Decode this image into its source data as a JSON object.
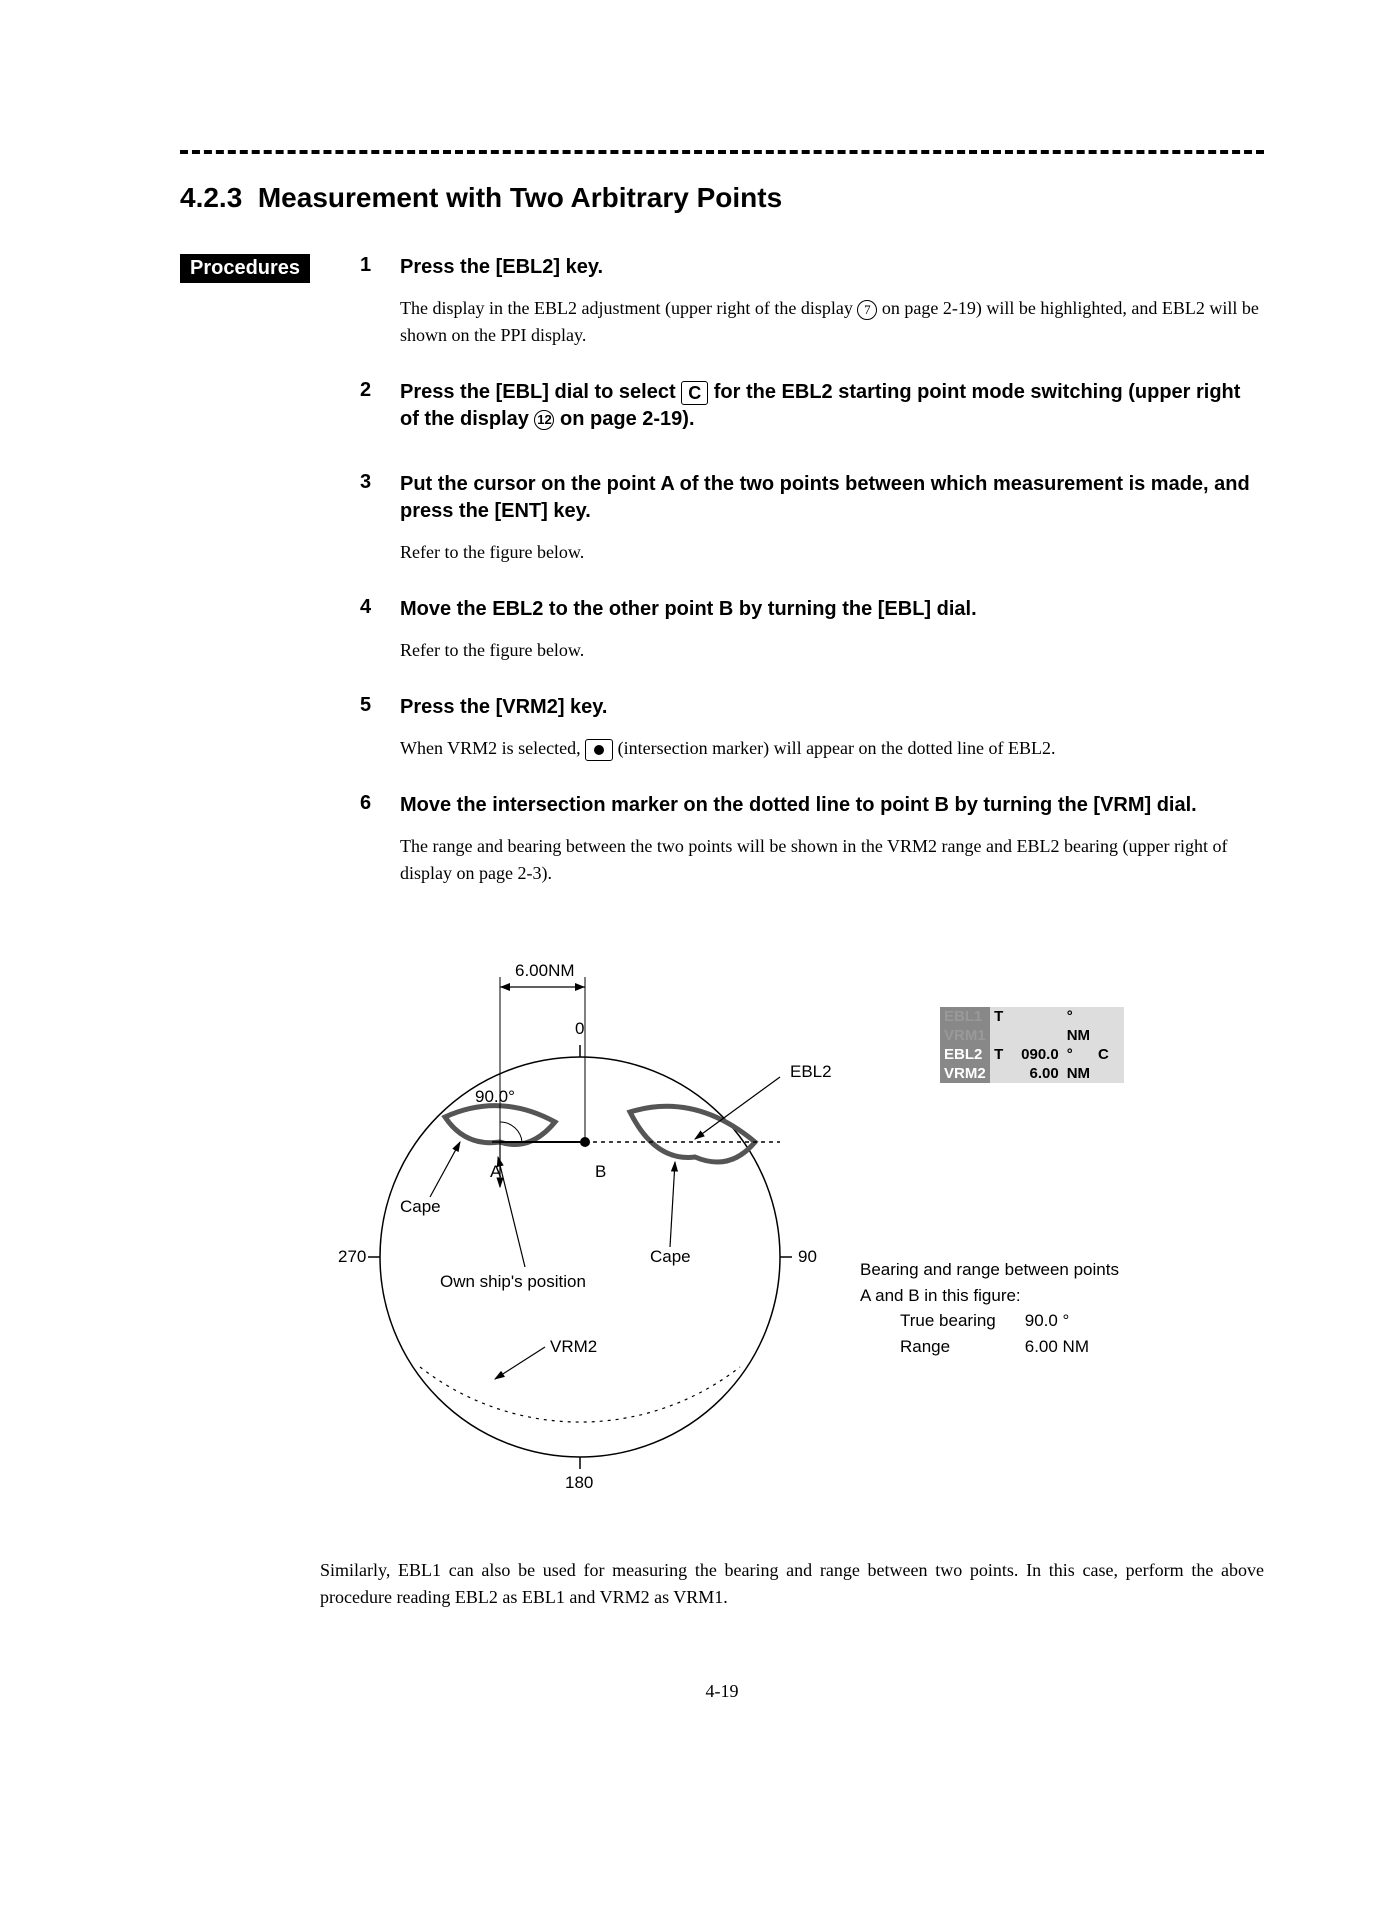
{
  "section": {
    "number": "4.2.3",
    "title": "Measurement with Two Arbitrary Points"
  },
  "procedures_label": "Procedures",
  "steps": [
    {
      "num": "1",
      "title_before": "Press the [EBL2] key.",
      "body_before": "The display in the EBL2 adjustment (upper right of the display ",
      "circled": "7",
      "body_after": " on page 2-19) will be highlighted, and EBL2 will be shown on the PPI display."
    },
    {
      "num": "2",
      "title_before": "Press the [EBL] dial to select ",
      "boxed": "C",
      "title_mid": " for the EBL2 starting point mode switching (upper right of the display ",
      "circled": "12",
      "title_after": " on page 2-19).",
      "body": ""
    },
    {
      "num": "3",
      "title": "Put the cursor on the point A of the two points between which measurement is made, and press the [ENT] key.",
      "body": "Refer to the figure below."
    },
    {
      "num": "4",
      "title": "Move the EBL2 to the other point B by turning the [EBL] dial.",
      "body": "Refer to the figure below."
    },
    {
      "num": "5",
      "title": "Press the [VRM2] key.",
      "body_before": "When VRM2 is selected, ",
      "body_after": " (intersection marker) will appear on the dotted line of EBL2."
    },
    {
      "num": "6",
      "title": "Move the intersection marker on the dotted line to point B by turning the [VRM] dial.",
      "body": "The range and bearing between the two points will be shown in the VRM2 range and EBL2 bearing (upper right of display on page 2-3)."
    }
  ],
  "figure": {
    "range_label": "6.00NM",
    "angles": {
      "top": "0",
      "right": "90",
      "bottom": "180",
      "left": "270"
    },
    "angle_text": "90.0°",
    "point_a": "A",
    "point_b": "B",
    "cape1": "Cape",
    "cape2": "Cape",
    "ebl2": "EBL2",
    "vrm2": "VRM2",
    "own_ship": "Own ship's position",
    "panel": {
      "rows": [
        {
          "label": "EBL1",
          "t": "T",
          "val": "",
          "unit": "°",
          "mode": ""
        },
        {
          "label": "VRM1",
          "t": "",
          "val": "",
          "unit": "NM",
          "mode": ""
        },
        {
          "label": "EBL2",
          "t": "T",
          "val": "090.0",
          "unit": "°",
          "mode": "C"
        },
        {
          "label": "VRM2",
          "t": "",
          "val": "6.00",
          "unit": "NM",
          "mode": ""
        }
      ]
    },
    "bearing_block": {
      "line1": "Bearing and range between points",
      "line2": "A and B in this figure:",
      "tb_label": "True bearing",
      "tb_value": "90.0 °",
      "rg_label": "Range",
      "rg_value": "6.00 NM"
    }
  },
  "closing_text": "Similarly, EBL1 can also be used for measuring the bearing and range between two points. In this case, perform the above procedure reading EBL2 as EBL1 and VRM2 as VRM1.",
  "page_number": "4-19"
}
